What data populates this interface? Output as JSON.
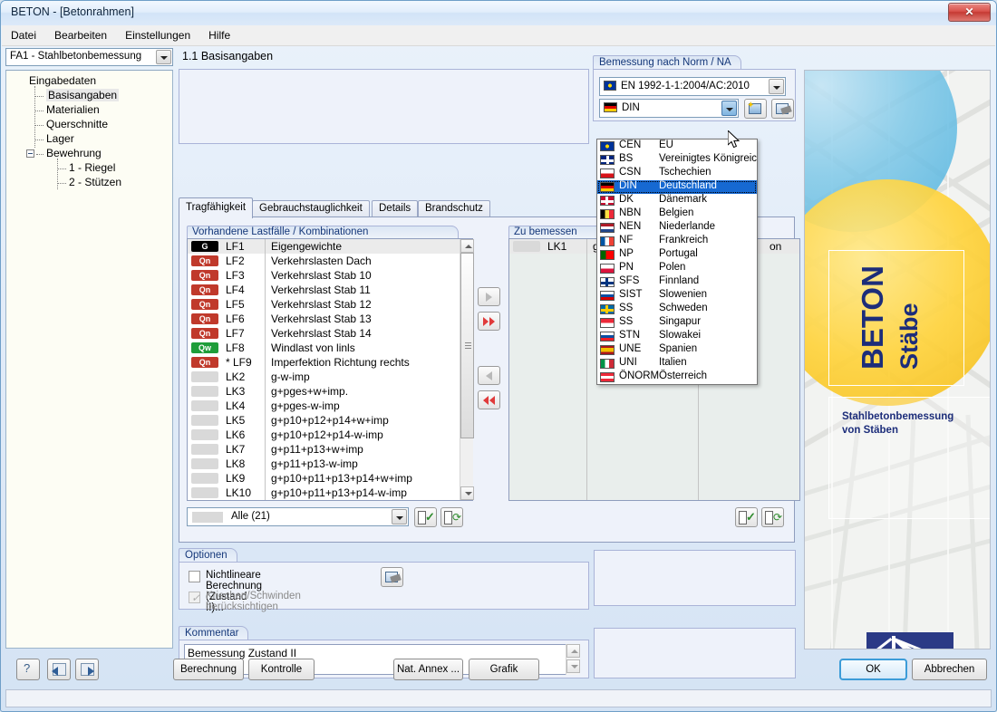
{
  "window": {
    "title": "BETON - [Betonrahmen]",
    "close_label": "✕"
  },
  "menubar": {
    "items": [
      {
        "label": "Datei"
      },
      {
        "label": "Bearbeiten"
      },
      {
        "label": "Einstellungen"
      },
      {
        "label": "Hilfe"
      }
    ]
  },
  "module_select": {
    "value": "FA1 - Stahlbetonbemessung"
  },
  "tree": {
    "root": "Eingabedaten",
    "items": [
      {
        "label": "Basisangaben",
        "selected": true
      },
      {
        "label": "Materialien",
        "selected": false
      },
      {
        "label": "Querschnitte",
        "selected": false
      },
      {
        "label": "Lager",
        "selected": false
      },
      {
        "label": "Bewehrung",
        "selected": false,
        "expandable": true
      }
    ],
    "children": [
      {
        "label": "1 - Riegel"
      },
      {
        "label": "2 - Stützen"
      }
    ]
  },
  "page": {
    "header": "1.1 Basisangaben"
  },
  "norm_group": {
    "title": "Bemessung nach Norm / NA",
    "norm_value": "EN 1992-1-1:2004/AC:2010",
    "na_value": "DIN",
    "new_button": "new-na-icon",
    "edit_button": "edit-na-icon"
  },
  "tabs": [
    {
      "label": "Tragfähigkeit",
      "active": true
    },
    {
      "label": "Gebrauchstauglichkeit",
      "active": false
    },
    {
      "label": "Details",
      "active": false
    },
    {
      "label": "Brandschutz",
      "active": false
    }
  ],
  "available_list": {
    "title": "Vorhandene Lastfälle / Kombinationen",
    "rows": [
      {
        "badge": "G",
        "badge_color": "#000000",
        "num": "LF1",
        "desc": "Eigengewichte",
        "highlighted": true
      },
      {
        "badge": "Qn",
        "badge_color": "#c0392b",
        "num": "LF2",
        "desc": "Verkehrslasten Dach"
      },
      {
        "badge": "Qn",
        "badge_color": "#c0392b",
        "num": "LF3",
        "desc": "Verkehrslast Stab 10"
      },
      {
        "badge": "Qn",
        "badge_color": "#c0392b",
        "num": "LF4",
        "desc": "Verkehrslast Stab 11"
      },
      {
        "badge": "Qn",
        "badge_color": "#c0392b",
        "num": "LF5",
        "desc": "Verkehrslast Stab 12"
      },
      {
        "badge": "Qn",
        "badge_color": "#c0392b",
        "num": "LF6",
        "desc": "Verkehrslast Stab 13"
      },
      {
        "badge": "Qn",
        "badge_color": "#c0392b",
        "num": "LF7",
        "desc": "Verkehrslast Stab 14"
      },
      {
        "badge": "Qw",
        "badge_color": "#1f9d3a",
        "num": "LF8",
        "desc": "Windlast von linls"
      },
      {
        "badge": "Qn",
        "badge_color": "#c0392b",
        "num": "* LF9",
        "desc": "Imperfektion Richtung rechts"
      },
      {
        "badge": "",
        "badge_color": "#d9d9d9",
        "num": "LK2",
        "desc": "g-w-imp"
      },
      {
        "badge": "",
        "badge_color": "#d9d9d9",
        "num": "LK3",
        "desc": "g+pges+w+imp."
      },
      {
        "badge": "",
        "badge_color": "#d9d9d9",
        "num": "LK4",
        "desc": "g+pges-w-imp"
      },
      {
        "badge": "",
        "badge_color": "#d9d9d9",
        "num": "LK5",
        "desc": "g+p10+p12+p14+w+imp"
      },
      {
        "badge": "",
        "badge_color": "#d9d9d9",
        "num": "LK6",
        "desc": "g+p10+p12+p14-w-imp"
      },
      {
        "badge": "",
        "badge_color": "#d9d9d9",
        "num": "LK7",
        "desc": "g+p11+p13+w+imp"
      },
      {
        "badge": "",
        "badge_color": "#d9d9d9",
        "num": "LK8",
        "desc": "g+p11+p13-w-imp"
      },
      {
        "badge": "",
        "badge_color": "#d9d9d9",
        "num": "LK9",
        "desc": "g+p10+p11+p13+p14+w+imp"
      },
      {
        "badge": "",
        "badge_color": "#d9d9d9",
        "num": "LK10",
        "desc": "g+p10+p11+p13+p14-w-imp"
      }
    ],
    "filter_value": "Alle (21)"
  },
  "transfer": {
    "add_one": "arrow-right-icon",
    "add_all": "arrow-double-right-icon",
    "remove_one": "arrow-left-icon",
    "remove_all": "arrow-double-left-icon"
  },
  "selected_list": {
    "title": "Zu bemessen",
    "rows": [
      {
        "badge": "",
        "num": "LK1",
        "desc": "g+w",
        "desc2": "on"
      }
    ]
  },
  "dropdown": {
    "items": [
      {
        "code": "CEN",
        "name": "EU",
        "flag": "eu",
        "selected": false
      },
      {
        "code": "BS",
        "name": "Vereinigtes Königreich",
        "flag": "gb",
        "selected": false
      },
      {
        "code": "CSN",
        "name": "Tschechien",
        "flag": "cz",
        "selected": false
      },
      {
        "code": "DIN",
        "name": "Deutschland",
        "flag": "de",
        "selected": true
      },
      {
        "code": "DK",
        "name": "Dänemark",
        "flag": "dk",
        "selected": false
      },
      {
        "code": "NBN",
        "name": "Belgien",
        "flag": "be",
        "selected": false
      },
      {
        "code": "NEN",
        "name": "Niederlande",
        "flag": "nl",
        "selected": false
      },
      {
        "code": "NF",
        "name": "Frankreich",
        "flag": "fr",
        "selected": false
      },
      {
        "code": "NP",
        "name": "Portugal",
        "flag": "pt",
        "selected": false
      },
      {
        "code": "PN",
        "name": "Polen",
        "flag": "pl",
        "selected": false
      },
      {
        "code": "SFS",
        "name": "Finnland",
        "flag": "fi",
        "selected": false
      },
      {
        "code": "SIST",
        "name": "Slowenien",
        "flag": "si",
        "selected": false
      },
      {
        "code": "SS",
        "name": "Schweden",
        "flag": "se",
        "selected": false
      },
      {
        "code": "SS",
        "name": "Singapur",
        "flag": "sg",
        "selected": false
      },
      {
        "code": "STN",
        "name": "Slowakei",
        "flag": "sk",
        "selected": false
      },
      {
        "code": "UNE",
        "name": "Spanien",
        "flag": "es",
        "selected": false
      },
      {
        "code": "UNI",
        "name": "Italien",
        "flag": "it",
        "selected": false
      },
      {
        "code": "ÖNORM",
        "name": "Österreich",
        "flag": "at",
        "selected": false
      }
    ]
  },
  "optionen": {
    "title": "Optionen",
    "checkbox1": {
      "label": "Nichtlineare Berechnung (Zustand II)...",
      "checked": false,
      "enabled": true
    },
    "checkbox2": {
      "label": "Kriechen/Schwinden berücksichtigen",
      "checked": true,
      "enabled": false
    },
    "settings_button": "nonlinear-settings-icon"
  },
  "kommentar": {
    "title": "Kommentar",
    "value": "Bemessung Zustand II"
  },
  "banner": {
    "title_line1": "BETON",
    "title_line2": "Stäbe",
    "subtitle_line1": "Stahlbetonbemessung",
    "subtitle_line2": "von Stäben"
  },
  "bottombar": {
    "help": "?",
    "prev": "back-icon",
    "next": "forward-icon",
    "buttons": [
      {
        "label": "Berechnung"
      },
      {
        "label": "Kontrolle"
      },
      {
        "label": "Nat. Annex ..."
      },
      {
        "label": "Grafik"
      }
    ],
    "ok": "OK",
    "cancel": "Abbrechen"
  },
  "colors": {
    "accent": "#1669d2",
    "title_text": "#15387a",
    "dead_load_badge": "#000000",
    "live_load_badge": "#c0392b",
    "wind_load_badge": "#1f9d3a"
  }
}
